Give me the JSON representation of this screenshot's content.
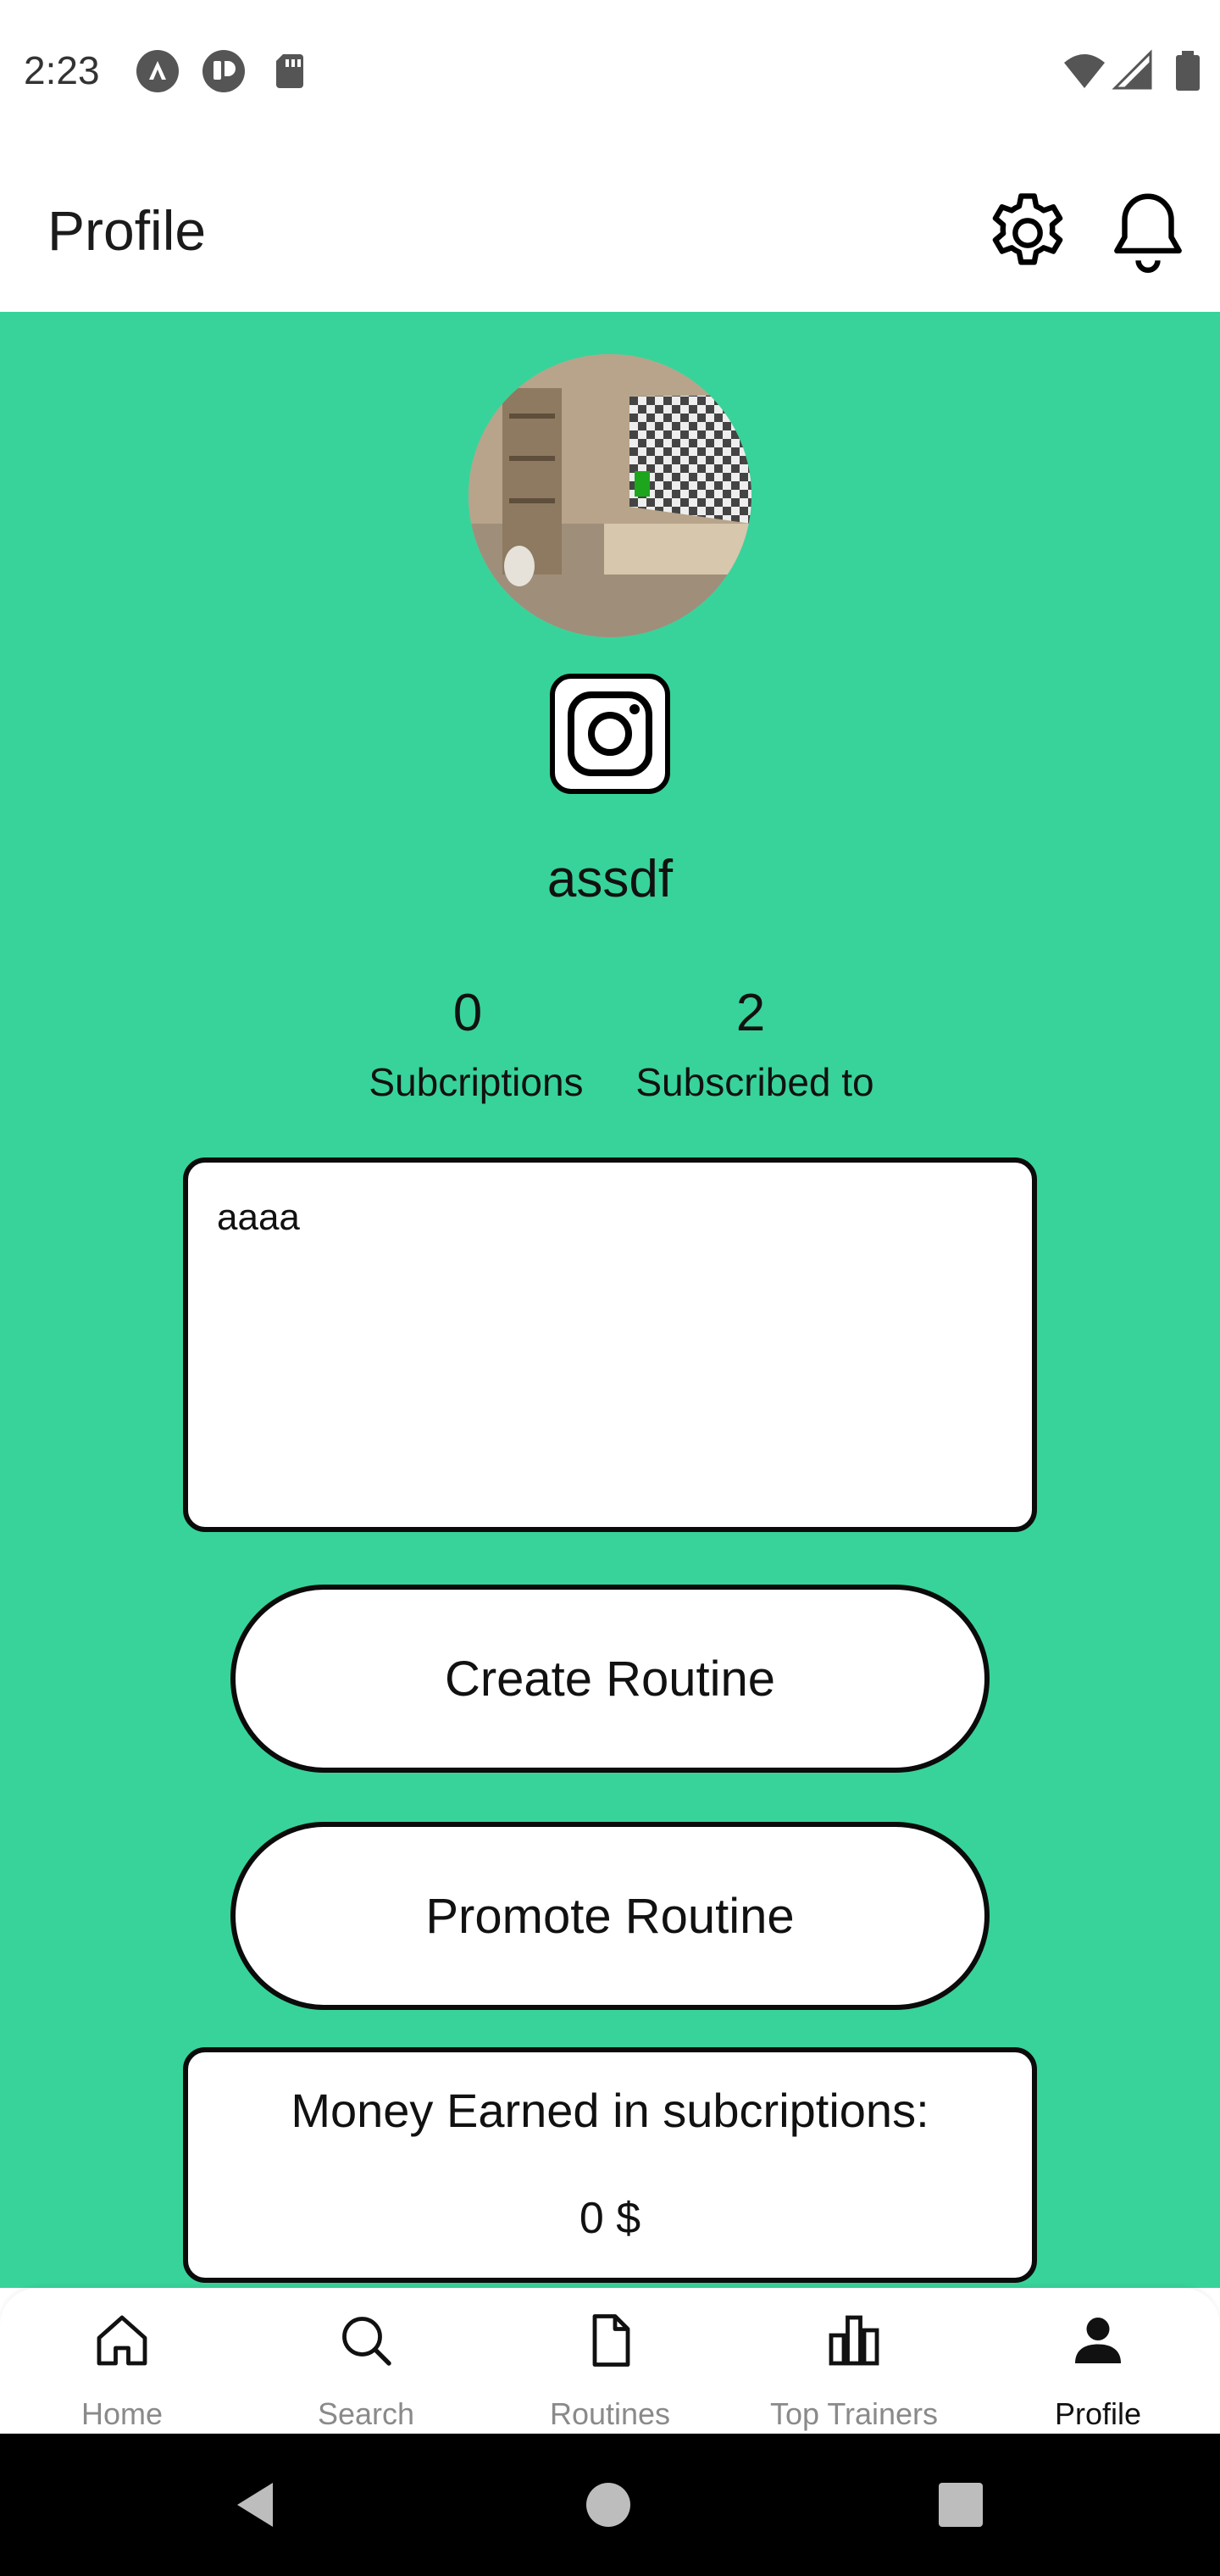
{
  "status_bar": {
    "time": "2:23",
    "left_icons": [
      "android-auto-icon",
      "app-notification-icon",
      "sd-card-icon"
    ],
    "right_icons": [
      "wifi-icon",
      "cell-signal-icon",
      "battery-icon"
    ]
  },
  "app_bar": {
    "title": "Profile",
    "actions": [
      "gear-icon",
      "bell-icon"
    ]
  },
  "profile": {
    "avatar": "room-photo",
    "social_icon": "instagram-icon",
    "username": "assdf",
    "stats": [
      {
        "value": "0",
        "label": "Subcriptions"
      },
      {
        "value": "2",
        "label": "Subscribed to"
      }
    ],
    "bio": "aaaa"
  },
  "actions": {
    "create_label": "Create Routine",
    "promote_label": "Promote Routine"
  },
  "earnings": {
    "label": "Money Earned in subcriptions:",
    "value": "0 $"
  },
  "bottom_nav": {
    "items": [
      {
        "label": "Home",
        "icon": "home-icon",
        "active": false
      },
      {
        "label": "Search",
        "icon": "search-icon",
        "active": false
      },
      {
        "label": "Routines",
        "icon": "document-icon",
        "active": false
      },
      {
        "label": "Top Trainers",
        "icon": "bar-chart-icon",
        "active": false
      },
      {
        "label": "Profile",
        "icon": "person-icon",
        "active": true
      }
    ]
  },
  "system_nav": [
    "back-icon",
    "home-circle-icon",
    "recents-icon"
  ],
  "colors": {
    "accent_green": "#38d39a",
    "border": "#0b0b0b",
    "inactive_nav": "#8a8a8a"
  }
}
